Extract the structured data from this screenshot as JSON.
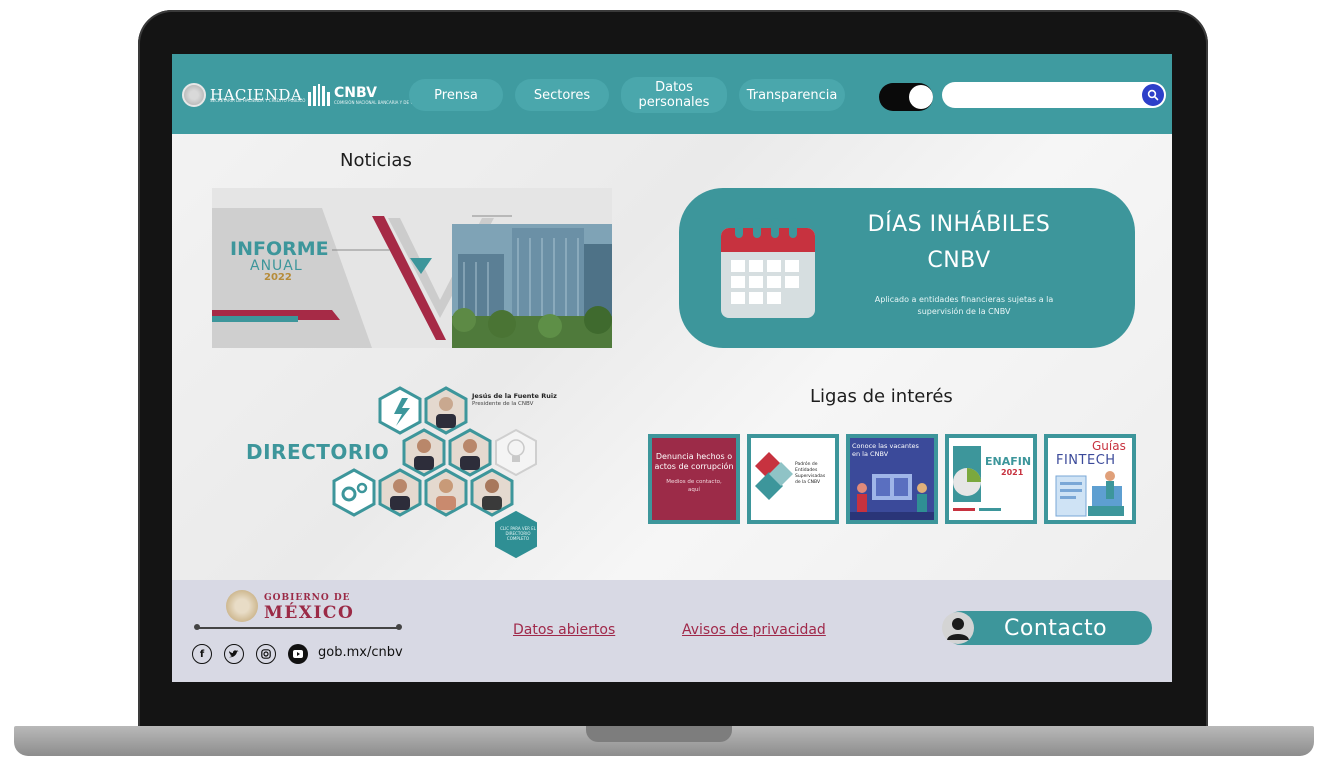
{
  "header": {
    "hacienda_logo": "HACIENDA",
    "hacienda_sub": "SECRETARÍA DE HACIENDA Y CRÉDITO PÚBLICO",
    "cnbv_logo": "CNBV",
    "cnbv_sub": "COMISIÓN NACIONAL BANCARIA Y DE VALORES",
    "nav": [
      {
        "label": "Prensa"
      },
      {
        "label": "Sectores"
      },
      {
        "label": "Datos personales"
      },
      {
        "label": "Transparencia"
      }
    ],
    "search_placeholder": "",
    "accent": "#3f9ba0"
  },
  "noticias": {
    "title": "Noticias",
    "banner": {
      "line1": "INFORME",
      "line2": "ANUAL",
      "year": "2022"
    }
  },
  "dias": {
    "title_line1": "DÍAS INHÁBILES",
    "title_line2": "CNBV",
    "subtitle": "Aplicado a entidades financieras sujetas a la supervisión de la CNBV"
  },
  "directorio": {
    "title": "DIRECTORIO",
    "person_name": "Jesús de la Fuente Ruiz",
    "person_role": "Presidente de la CNBV",
    "cta": "CLIC PARA VER EL DIRECTORIO COMPLETO"
  },
  "ligas": {
    "title": "Ligas de interés",
    "items": [
      {
        "line1": "Denuncia hechos o",
        "line2": "actos de corrupción",
        "line3": "Medios de contacto,",
        "line4": "aquí",
        "bg": "#9c2b48"
      },
      {
        "line1": "Padrón de",
        "line2": "Entidades",
        "line3": "Supervisadas",
        "line4": "de la CNBV",
        "bg": "#ffffff"
      },
      {
        "line1": "Conoce las vacantes",
        "line2": "en la CNBV",
        "bg": "#3b4a9a"
      },
      {
        "line1": "ENAFIN",
        "line2": "2021",
        "bg": "#ffffff"
      },
      {
        "line1": "Guías",
        "line2": "FINTECH",
        "bg": "#ffffff"
      }
    ]
  },
  "footer": {
    "gob_small": "GOBIERNO DE",
    "gob_big": "MÉXICO",
    "url": "gob.mx/cnbv",
    "links": [
      {
        "label": "Datos abiertos"
      },
      {
        "label": "Avisos de privacidad"
      }
    ],
    "contacto": "Contacto"
  }
}
